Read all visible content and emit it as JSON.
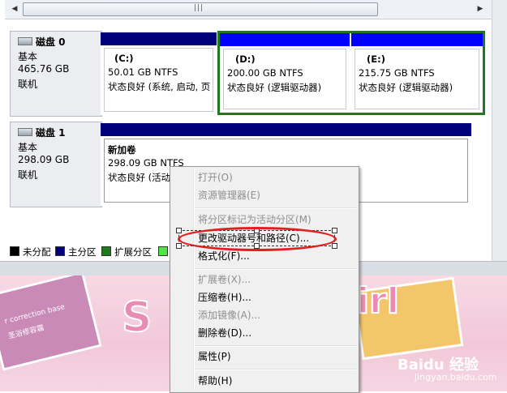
{
  "scrollbar": {
    "left_arrow": "◀",
    "right_arrow": "▶",
    "grip": "|||"
  },
  "disks": [
    {
      "name": "磁盘 0",
      "type": "基本",
      "size": "465.76 GB",
      "status": "联机",
      "partitions": [
        {
          "label": "(C:)",
          "size": "50.01 GB NTFS",
          "status": "状态良好 (系统, 启动, 页"
        },
        {
          "label": "(D:)",
          "size": "200.00 GB NTFS",
          "status": "状态良好 (逻辑驱动器)"
        },
        {
          "label": "(E:)",
          "size": "215.75 GB NTFS",
          "status": "状态良好 (逻辑驱动器)"
        }
      ]
    },
    {
      "name": "磁盘 1",
      "type": "基本",
      "size": "298.09 GB",
      "status": "联机",
      "partitions": [
        {
          "label": "新加卷",
          "size": "298.09 GB NTFS",
          "status": "状态良好 (活动"
        }
      ]
    }
  ],
  "legend": [
    {
      "label": "未分配",
      "color": "#000000"
    },
    {
      "label": "主分区",
      "color": "#00007a"
    },
    {
      "label": "扩展分区",
      "color": "#1d7a1d"
    }
  ],
  "colors": {
    "primary_bar": "#00007a",
    "logical_bar": "#0000ff",
    "extended": "#1d7a1d",
    "annotation": "#e02020"
  },
  "wallpaper": {
    "card_text_1": "r correction base",
    "card_text_2": "圣浴修容霜",
    "title_left": "S",
    "title_right": "irl",
    "watermark": "Baidu 经验",
    "watermark_sub": "jingyan.baidu.com"
  },
  "context_menu": {
    "items": [
      {
        "label": "打开(O)",
        "enabled": false
      },
      {
        "label": "资源管理器(E)",
        "enabled": false
      },
      {
        "label": "将分区标记为活动分区(M)",
        "enabled": false
      },
      {
        "label": "更改驱动器号和路径(C)...",
        "enabled": true
      },
      {
        "label": "格式化(F)...",
        "enabled": true
      },
      {
        "label": "扩展卷(X)...",
        "enabled": false
      },
      {
        "label": "压缩卷(H)...",
        "enabled": true
      },
      {
        "label": "添加镜像(A)...",
        "enabled": false
      },
      {
        "label": "删除卷(D)...",
        "enabled": true
      },
      {
        "label": "属性(P)",
        "enabled": true
      },
      {
        "label": "帮助(H)",
        "enabled": true
      }
    ]
  }
}
